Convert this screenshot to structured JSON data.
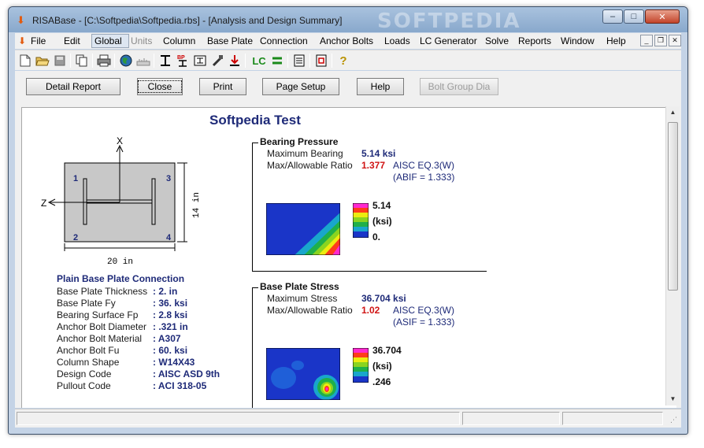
{
  "window": {
    "title": "RISABase - [C:\\Softpedia\\Softpedia.rbs] - [Analysis and Design Summary]",
    "watermark": "SOFTPEDIA",
    "minimize": "–",
    "maximize": "□",
    "close": "✕"
  },
  "menu": {
    "items": [
      "File",
      "Edit",
      "Global",
      "Units",
      "Column",
      "Base Plate",
      "Connection",
      "Anchor Bolts",
      "Loads",
      "LC Generator",
      "Solve",
      "Reports",
      "Window",
      "Help"
    ],
    "disabled": [
      "Units"
    ],
    "highlighted": "Global",
    "mdi_minimize": "_",
    "mdi_restore": "❐",
    "mdi_close": "✕"
  },
  "toolbar": {
    "icons": [
      "new-file-icon",
      "open-folder-icon",
      "save-icon",
      "copy-icon",
      "print-icon",
      "globe-icon",
      "units-icon",
      "column-icon",
      "base-plate-icon",
      "connection-icon",
      "anchor-bolt-icon",
      "loads-icon",
      "load-combination-icon",
      "lc-generator-icon",
      "report-icon",
      "detail-icon",
      "help-icon"
    ],
    "lc_label": "LC",
    "bp_label": "BP"
  },
  "buttons": {
    "detail_report": "Detail Report",
    "close": "Close",
    "print": "Print",
    "page_setup": "Page Setup",
    "help": "Help",
    "bolt_group_dia": "Bolt Group Dia"
  },
  "report": {
    "title": "Softpedia Test",
    "diagram": {
      "x_axis": "X",
      "z_axis": "Z",
      "width_dim": "20 in",
      "height_dim": "14 in",
      "bolt_labels": [
        "1",
        "2",
        "3",
        "4"
      ]
    },
    "connection": {
      "title": "Plain Base Plate Connection",
      "rows": [
        {
          "label": "Base Plate Thickness",
          "value": ": 2. in"
        },
        {
          "label": "Base Plate Fy",
          "value": ": 36. ksi"
        },
        {
          "label": "Bearing Surface Fp",
          "value": ": 2.8 ksi"
        },
        {
          "label": "Anchor Bolt Diameter",
          "value": ": .321 in"
        },
        {
          "label": "Anchor Bolt Material",
          "value": ": A307"
        },
        {
          "label": "Anchor Bolt Fu",
          "value": ": 60. ksi"
        },
        {
          "label": "Column Shape",
          "value": ": W14X43"
        },
        {
          "label": "Design Code",
          "value": ": AISC ASD 9th"
        },
        {
          "label": "Pullout Code",
          "value": ": ACI 318-05"
        }
      ]
    },
    "bearing": {
      "title": "Bearing Pressure",
      "max_label": "Maximum Bearing",
      "max_value": "5.14 ksi",
      "ratio_label": "Max/Allowable Ratio",
      "ratio_value": "1.377",
      "eq": "AISC EQ.3(W)",
      "factor": "(ABIF = 1.333)",
      "legend_max": "5.14",
      "legend_unit": "(ksi)",
      "legend_min": "0."
    },
    "stress": {
      "title": "Base Plate Stress",
      "max_label": "Maximum Stress",
      "max_value": "36.704 ksi",
      "ratio_label": "Max/Allowable Ratio",
      "ratio_value": "1.02",
      "eq": "AISC EQ.3(W)",
      "factor": "(ASIF = 1.333)",
      "legend_max": "36.704",
      "legend_unit": "(ksi)",
      "legend_min": ".246"
    }
  },
  "colors": {
    "accent_navy": "#1e2a78",
    "ratio_red": "#d01414",
    "contour_blue": "#1a35c8"
  }
}
